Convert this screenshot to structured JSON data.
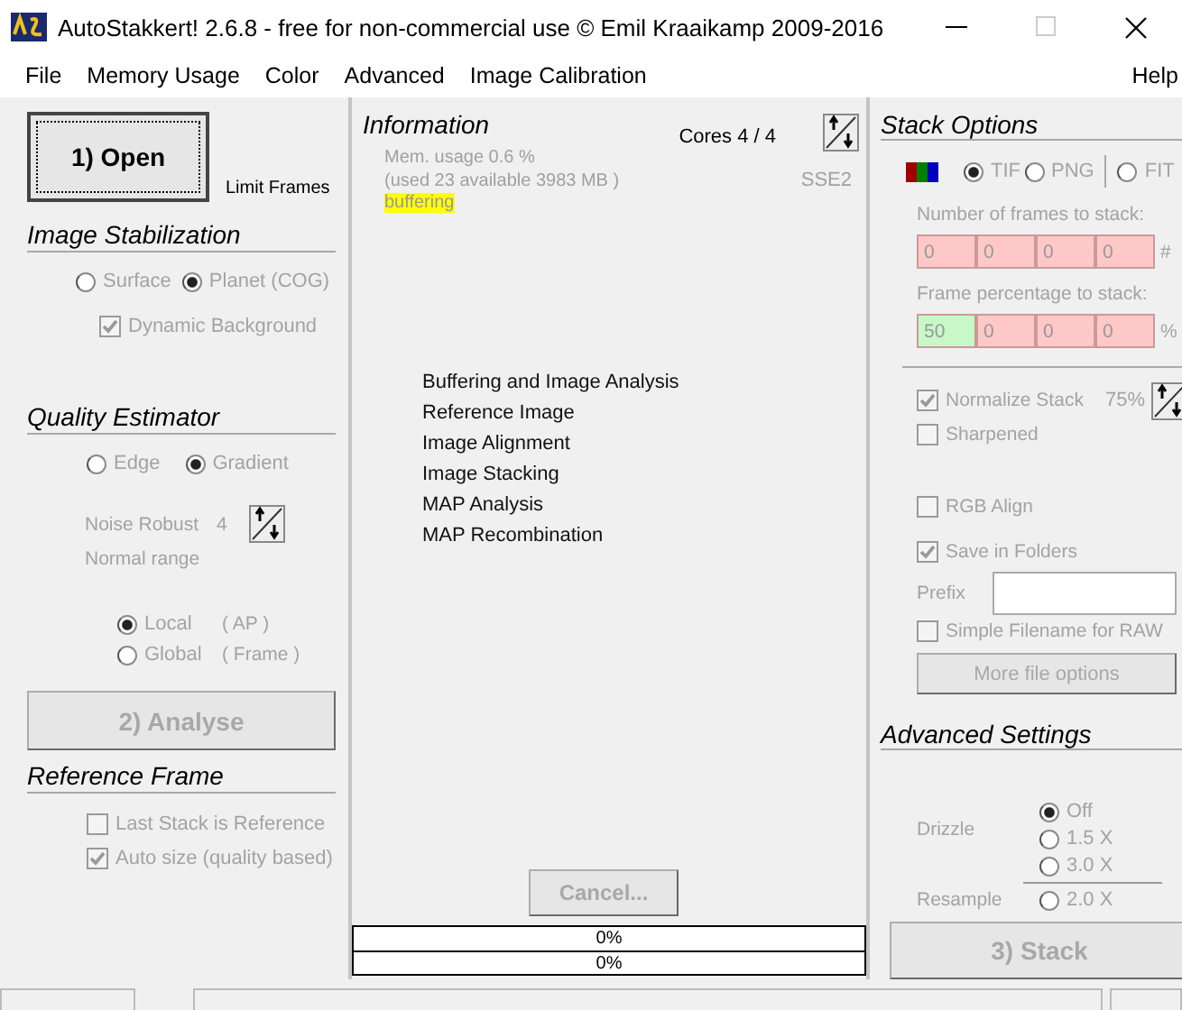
{
  "window": {
    "title": "AutoStakkert! 2.6.8 - free for non-commercial use © Emil Kraaikamp 2009-2016"
  },
  "menu": [
    "File",
    "Memory Usage",
    "Color",
    "Advanced",
    "Image Calibration",
    "Help"
  ],
  "left": {
    "open_button": {
      "label": "1) Open",
      "disabled": false
    },
    "limit_frames": "Limit Frames",
    "stabilization": {
      "title": "Image Stabilization",
      "disabled": true,
      "options": [
        {
          "label": "Surface",
          "selected": false
        },
        {
          "label": "Planet (COG)",
          "selected": true
        }
      ],
      "dynamic_background": {
        "label": "Dynamic Background",
        "checked": true
      }
    },
    "quality": {
      "title": "Quality Estimator",
      "disabled": true,
      "options": [
        {
          "label": "Edge",
          "selected": false
        },
        {
          "label": "Gradient",
          "selected": true
        }
      ],
      "noise_label": "Noise Robust",
      "noise_value": "4",
      "range": "Normal range",
      "scope": [
        {
          "label": "Local",
          "note": "( AP )",
          "selected": true
        },
        {
          "label": "Global",
          "note": "( Frame )",
          "selected": false
        }
      ]
    },
    "analyse_button": {
      "label": "2) Analyse",
      "disabled": true
    },
    "reference": {
      "title": "Reference Frame",
      "disabled": true,
      "checks": [
        {
          "label": "Last Stack is Reference",
          "checked": false
        },
        {
          "label": "Auto size (quality based)",
          "checked": true
        }
      ]
    }
  },
  "information": {
    "title": "Information",
    "cores": "Cores 4 / 4",
    "memory": "Mem. usage 0.6 %",
    "memory_detail": "(used 23 available 3983 MB )",
    "status": "buffering",
    "cpu": "SSE2",
    "steps": [
      "Buffering and Image Analysis",
      "Reference Image",
      "Image Alignment",
      "Image Stacking",
      "MAP Analysis",
      "MAP Recombination"
    ],
    "cancel_button": {
      "label": "Cancel...",
      "disabled": true
    },
    "progress": [
      {
        "label": "0%",
        "level": 0
      },
      {
        "label": "0%",
        "level": 0
      }
    ]
  },
  "stack_options": {
    "title": "Stack Options",
    "disabled": true,
    "formats": [
      {
        "label": "TIF",
        "selected": true
      },
      {
        "label": "PNG",
        "selected": false
      },
      {
        "label": "FIT",
        "selected": false
      }
    ],
    "frames_label": "Number of frames to stack:",
    "frames": [
      {
        "value": "0",
        "active": false
      },
      {
        "value": "0",
        "active": false
      },
      {
        "value": "0",
        "active": false
      },
      {
        "value": "0",
        "active": false
      }
    ],
    "frames_unit": "#",
    "percentage_label": "Frame percentage to stack:",
    "percentages": [
      {
        "value": "50",
        "active": true
      },
      {
        "value": "0",
        "active": false
      },
      {
        "value": "0",
        "active": false
      },
      {
        "value": "0",
        "active": false
      }
    ],
    "percentage_unit": "%",
    "normalize": {
      "label": "Normalize Stack",
      "checked": true
    },
    "normalize_value": "75%",
    "sharpened": {
      "label": "Sharpened",
      "checked": false
    },
    "rgb_align": {
      "label": "RGB Align",
      "checked": false
    },
    "save_in_folders": {
      "label": "Save in Folders",
      "checked": true
    },
    "prefix_label": "Prefix",
    "simple_filename": {
      "label": "Simple Filename for RAW",
      "checked": false
    },
    "more_button": {
      "label": "More file options",
      "disabled": true
    }
  },
  "advanced": {
    "title": "Advanced Settings",
    "disabled": true,
    "drizzle_label": "Drizzle",
    "drizzle": [
      {
        "label": "Off",
        "selected": true
      },
      {
        "label": "1.5 X",
        "selected": false
      },
      {
        "label": "3.0 X",
        "selected": false
      }
    ],
    "resample_label": "Resample",
    "resample": [
      {
        "label": "2.0 X",
        "selected": false
      }
    ],
    "stack_button": {
      "label": "3) Stack",
      "disabled": true
    }
  }
}
